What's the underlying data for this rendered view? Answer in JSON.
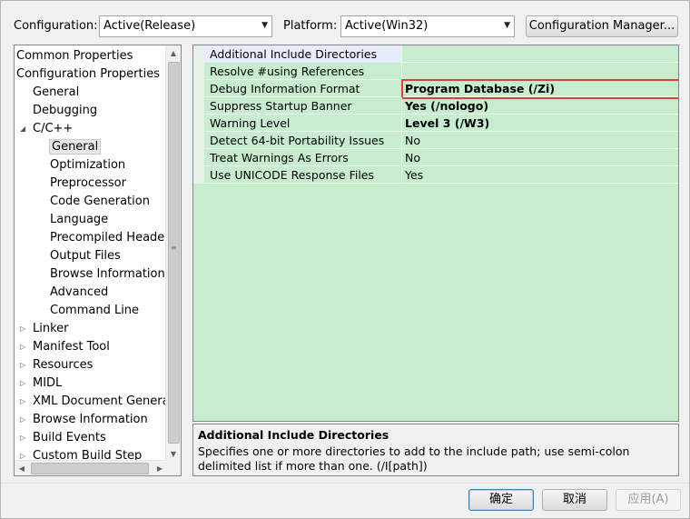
{
  "toolbar": {
    "configuration_label": "Configuration:",
    "configuration_value": "Active(Release)",
    "platform_label": "Platform:",
    "platform_value": "Active(Win32)",
    "config_manager_label": "Configuration Manager..."
  },
  "tree": {
    "items": [
      {
        "label": "Common Properties",
        "level": 0,
        "expander": "none",
        "selected": false
      },
      {
        "label": "Configuration Properties",
        "level": 0,
        "expander": "none",
        "selected": false
      },
      {
        "label": "General",
        "level": 1,
        "expander": "none",
        "selected": false
      },
      {
        "label": "Debugging",
        "level": 1,
        "expander": "none",
        "selected": false
      },
      {
        "label": "C/C++",
        "level": 1,
        "expander": "expanded",
        "selected": false
      },
      {
        "label": "General",
        "level": 2,
        "expander": "none",
        "selected": true
      },
      {
        "label": "Optimization",
        "level": 2,
        "expander": "none",
        "selected": false
      },
      {
        "label": "Preprocessor",
        "level": 2,
        "expander": "none",
        "selected": false
      },
      {
        "label": "Code Generation",
        "level": 2,
        "expander": "none",
        "selected": false
      },
      {
        "label": "Language",
        "level": 2,
        "expander": "none",
        "selected": false
      },
      {
        "label": "Precompiled Headers",
        "level": 2,
        "expander": "none",
        "selected": false
      },
      {
        "label": "Output Files",
        "level": 2,
        "expander": "none",
        "selected": false
      },
      {
        "label": "Browse Information",
        "level": 2,
        "expander": "none",
        "selected": false
      },
      {
        "label": "Advanced",
        "level": 2,
        "expander": "none",
        "selected": false
      },
      {
        "label": "Command Line",
        "level": 2,
        "expander": "none",
        "selected": false
      },
      {
        "label": "Linker",
        "level": 1,
        "expander": "collapsed",
        "selected": false
      },
      {
        "label": "Manifest Tool",
        "level": 1,
        "expander": "collapsed",
        "selected": false
      },
      {
        "label": "Resources",
        "level": 1,
        "expander": "collapsed",
        "selected": false
      },
      {
        "label": "MIDL",
        "level": 1,
        "expander": "collapsed",
        "selected": false
      },
      {
        "label": "XML Document Generato",
        "level": 1,
        "expander": "collapsed",
        "selected": false
      },
      {
        "label": "Browse Information",
        "level": 1,
        "expander": "collapsed",
        "selected": false
      },
      {
        "label": "Build Events",
        "level": 1,
        "expander": "collapsed",
        "selected": false
      },
      {
        "label": "Custom Build Step",
        "level": 1,
        "expander": "collapsed",
        "selected": false
      }
    ]
  },
  "properties": [
    {
      "name": "Additional Include Directories",
      "value": "",
      "bold": false,
      "highlighted": false
    },
    {
      "name": "Resolve #using References",
      "value": "",
      "bold": false,
      "highlighted": false
    },
    {
      "name": "Debug Information Format",
      "value": "Program Database (/Zi)",
      "bold": true,
      "highlighted": true
    },
    {
      "name": "Suppress Startup Banner",
      "value": "Yes (/nologo)",
      "bold": true,
      "highlighted": false
    },
    {
      "name": "Warning Level",
      "value": "Level 3 (/W3)",
      "bold": true,
      "highlighted": false
    },
    {
      "name": "Detect 64-bit Portability Issues",
      "value": "No",
      "bold": false,
      "highlighted": false
    },
    {
      "name": "Treat Warnings As Errors",
      "value": "No",
      "bold": false,
      "highlighted": false
    },
    {
      "name": "Use UNICODE Response Files",
      "value": "Yes",
      "bold": false,
      "highlighted": false
    }
  ],
  "description": {
    "title": "Additional Include Directories",
    "text": "Specifies one or more directories to add to the include path; use semi-colon delimited list if more than one.     (/I[path])"
  },
  "footer": {
    "ok_label": "确定",
    "cancel_label": "取消",
    "apply_label": "应用(A)"
  },
  "colors": {
    "grid_background": "#c8ecce",
    "highlight_border": "#e0403a"
  }
}
